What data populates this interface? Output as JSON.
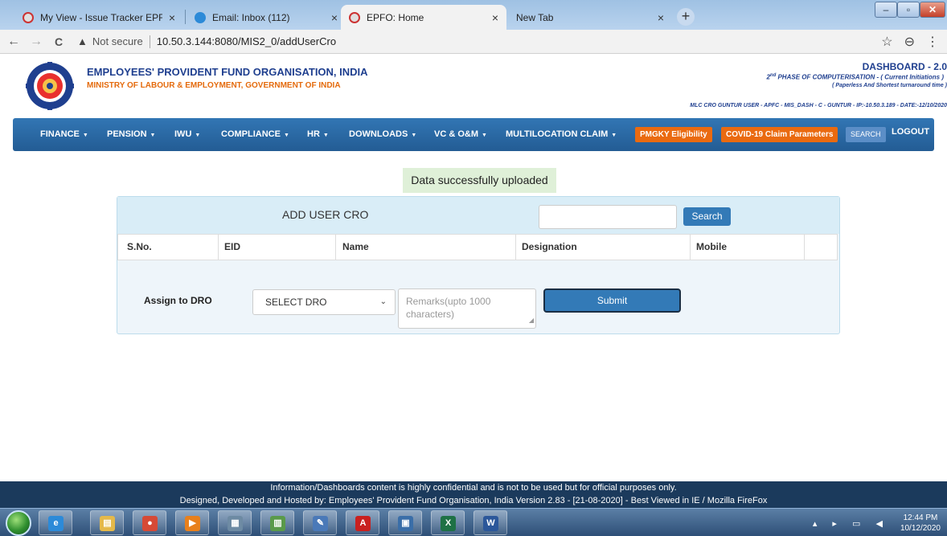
{
  "browser": {
    "tabs": [
      {
        "title": "My View - Issue Tracker EPFO",
        "close": "×"
      },
      {
        "title": "Email: Inbox (112)",
        "close": "×"
      },
      {
        "title": "EPFO: Home",
        "close": "×"
      },
      {
        "title": "New Tab",
        "close": "×"
      }
    ],
    "new_tab": "+",
    "window_controls": {
      "minimize": "–",
      "maximize": "▫",
      "close": "✕"
    },
    "nav": {
      "back": "←",
      "forward": "→",
      "reload": "C"
    },
    "security_label": "Not secure",
    "url": "10.50.3.144:8080/MIS2_0/addUserCro",
    "warning_glyph": "▲",
    "star_glyph": "☆",
    "profile_glyph": "⊖",
    "menu_glyph": "⋮"
  },
  "header": {
    "org_name": "EMPLOYEES' PROVIDENT FUND ORGANISATION, INDIA",
    "ministry": "MINISTRY OF LABOUR & EMPLOYMENT, GOVERNMENT OF INDIA",
    "dashboard": "DASHBOARD - 2.0",
    "phase_nd": "nd",
    "phase_2": "2",
    "phase_text": " PHASE OF COMPUTERISATION -   ( Current Initiations )",
    "phase_sub": "( Paperless And Shortest turnaround time )",
    "user_info": "MLC CRO GUNTUR USER  - APFC  - MIS_DASH  - C  - GUNTUR -  IP:-10.50.3.189  - DATE:-12/10/2020"
  },
  "nav": {
    "items": [
      "FINANCE",
      "PENSION",
      "IWU",
      "COMPLIANCE",
      "HR",
      "DOWNLOADS",
      "VC & O&M",
      "MULTILOCATION CLAIM"
    ],
    "caret": "▼",
    "pmgky": "PMGKY Eligibility",
    "covid": "COVID-19 Claim Parameters",
    "search": "SEARCH",
    "logout": "LOGOUT"
  },
  "content": {
    "success_message": "Data successfully uploaded",
    "panel_title": "ADD USER CRO",
    "search_value": "",
    "search_button": "Search",
    "table_headers": [
      "S.No.",
      "EID",
      "Name",
      "Designation",
      "Mobile"
    ],
    "assign_label": "Assign to DRO",
    "dro_select": "SELECT DRO",
    "dro_chevron": "⌄",
    "remarks_placeholder": "Remarks(upto 1000 characters)",
    "submit_button": "Submit"
  },
  "footer": {
    "line1": "Information/Dashboards content is highly confidential and is not to be used but for official purposes only.",
    "line2": "Designed, Developed and Hosted by: Employees' Provident Fund Organisation, India Version 2.83 - [21-08-2020] - Best Viewed in IE / Mozilla FireFox"
  },
  "taskbar": {
    "apps": [
      {
        "name": "internet-explorer",
        "glyph": "e",
        "color": "#2c8ad8"
      },
      {
        "name": "file-explorer",
        "glyph": "▤",
        "color": "#e5b94a"
      },
      {
        "name": "chrome",
        "glyph": "●",
        "color": "#d64a36"
      },
      {
        "name": "media-player",
        "glyph": "▶",
        "color": "#e8801c"
      },
      {
        "name": "calculator",
        "glyph": "▦",
        "color": "#6d8aa3"
      },
      {
        "name": "project",
        "glyph": "▥",
        "color": "#5a9a4a"
      },
      {
        "name": "notes",
        "glyph": "✎",
        "color": "#4a79b8"
      },
      {
        "name": "acrobat",
        "glyph": "A",
        "color": "#c9201f"
      },
      {
        "name": "remote-desktop",
        "glyph": "▣",
        "color": "#3a6ea8"
      },
      {
        "name": "excel",
        "glyph": "X",
        "color": "#1e7145"
      },
      {
        "name": "word",
        "glyph": "W",
        "color": "#2b579a"
      }
    ],
    "tray_icons": "▴ ▸ ▭ ◀",
    "time": "12:44 PM",
    "date": "10/12/2020"
  },
  "colors": {
    "nav_blue": "#2b6ca8",
    "header_navy": "#1f3f8f",
    "orange": "#ea6a10",
    "success_bg": "#dff0d8",
    "footer_bg": "#1b3a5c"
  }
}
